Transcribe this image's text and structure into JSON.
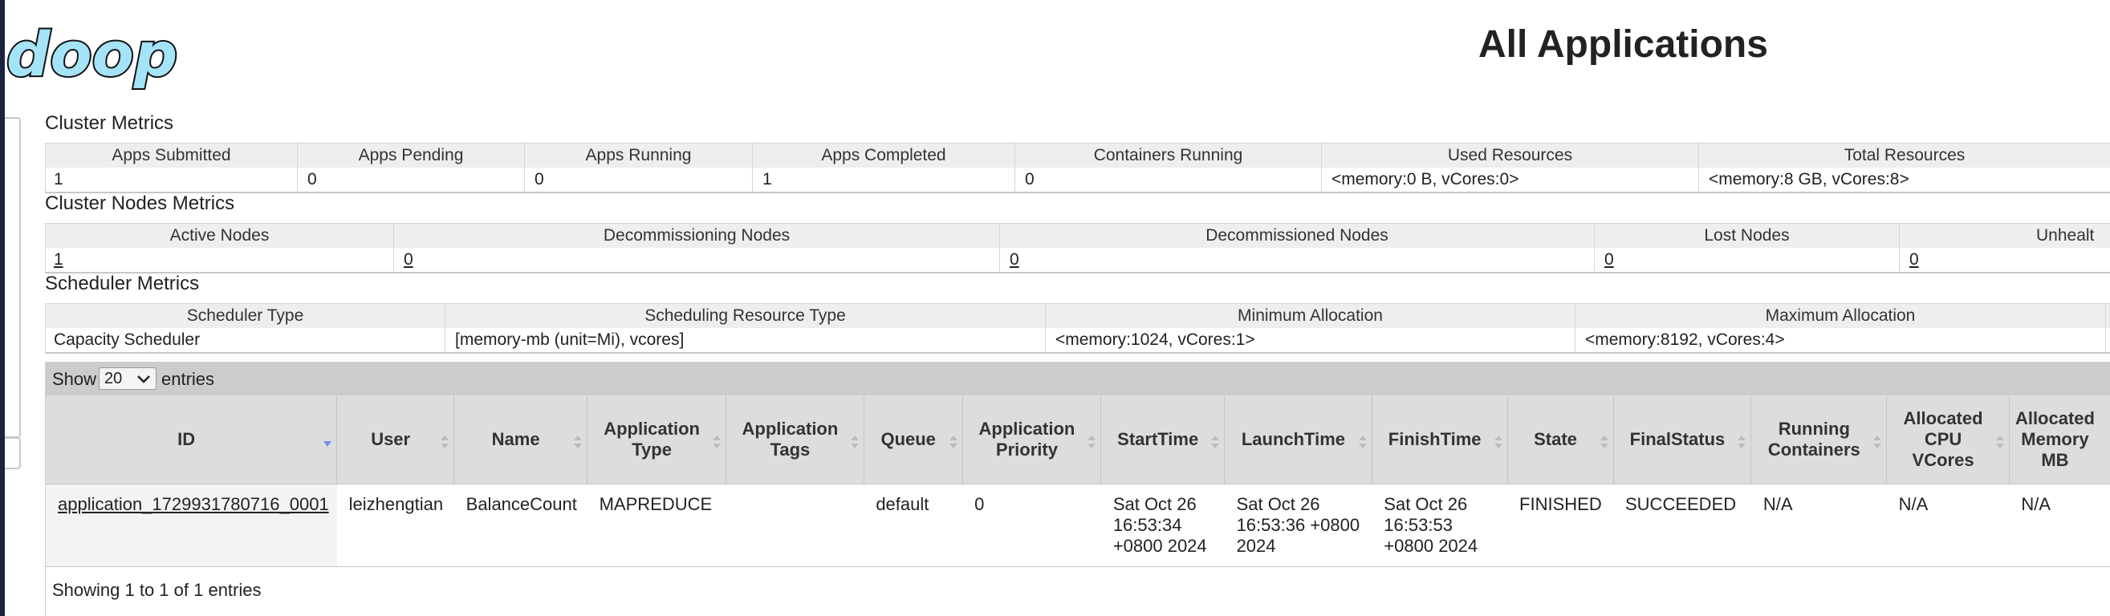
{
  "header": {
    "logo_text": "doop",
    "page_title": "All Applications"
  },
  "cluster_metrics": {
    "title": "Cluster Metrics",
    "headers": [
      "Apps Submitted",
      "Apps Pending",
      "Apps Running",
      "Apps Completed",
      "Containers Running",
      "Used Resources",
      "Total Resources"
    ],
    "values": [
      "1",
      "0",
      "0",
      "1",
      "0",
      "<memory:0 B, vCores:0>",
      "<memory:8 GB, vCores:8>"
    ]
  },
  "cluster_nodes_metrics": {
    "title": "Cluster Nodes Metrics",
    "headers": [
      "Active Nodes",
      "Decommissioning Nodes",
      "Decommissioned Nodes",
      "Lost Nodes",
      "Unhealt"
    ],
    "values": [
      "1",
      "0",
      "0",
      "0",
      "0"
    ]
  },
  "scheduler_metrics": {
    "title": "Scheduler Metrics",
    "headers": [
      "Scheduler Type",
      "Scheduling Resource Type",
      "Minimum Allocation",
      "Maximum Allocation"
    ],
    "values": [
      "Capacity Scheduler",
      "[memory-mb (unit=Mi), vcores]",
      "<memory:1024, vCores:1>",
      "<memory:8192, vCores:4>"
    ]
  },
  "apps": {
    "show_label": "Show",
    "entries_label": "entries",
    "page_size": "20",
    "columns": {
      "id": "ID",
      "user": "User",
      "name": "Name",
      "app_type": [
        "Application",
        "Type"
      ],
      "app_tags": [
        "Application",
        "Tags"
      ],
      "queue": "Queue",
      "priority": [
        "Application",
        "Priority"
      ],
      "start_time": "StartTime",
      "launch_time": "LaunchTime",
      "finish_time": "FinishTime",
      "state": "State",
      "final_status": "FinalStatus",
      "running_containers": [
        "Running",
        "Containers"
      ],
      "alloc_cpu": [
        "Allocated",
        "CPU",
        "VCores"
      ],
      "alloc_mem": [
        "Allocated",
        "Memory",
        "MB"
      ]
    },
    "rows": [
      {
        "id": "application_1729931780716_0001",
        "user": "leizhengtian",
        "name": "BalanceCount",
        "app_type": "MAPREDUCE",
        "app_tags": "",
        "queue": "default",
        "priority": "0",
        "start_time": [
          "Sat Oct 26",
          "16:53:34",
          "+0800 2024"
        ],
        "launch_time": [
          "Sat Oct 26",
          "16:53:36 +0800",
          "2024"
        ],
        "finish_time": [
          "Sat Oct 26",
          "16:53:53",
          "+0800 2024"
        ],
        "state": "FINISHED",
        "final_status": "SUCCEEDED",
        "running_containers": "N/A",
        "alloc_cpu": "N/A",
        "alloc_mem": "N/A"
      }
    ],
    "footer_info": "Showing 1 to 1 of 1 entries"
  },
  "colors": {
    "logo_fill": "#a4e3f8",
    "logo_stroke": "#111111",
    "sort_active": "#6f8fe6",
    "sort_inactive": "#bcbcbc"
  }
}
